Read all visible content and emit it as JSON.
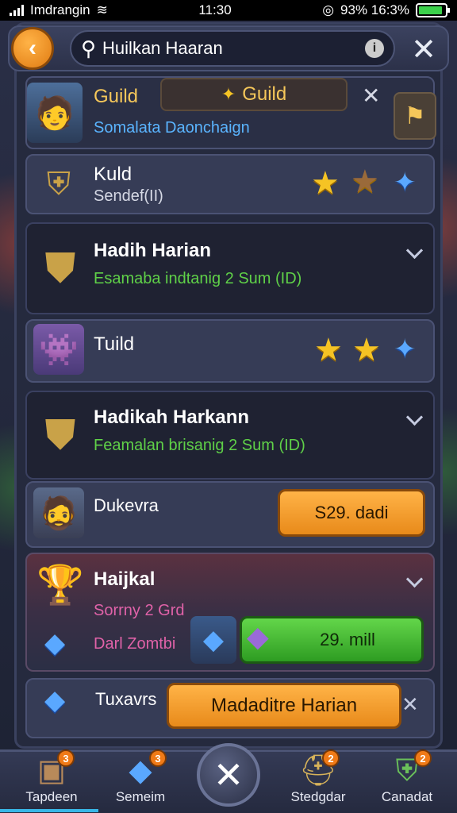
{
  "status_bar": {
    "carrier": "Imdrangin",
    "time": "11:30",
    "battery_text": "93% 16:3%"
  },
  "header": {
    "search_value": "Huilkan Haaran"
  },
  "guild_row": {
    "title": "Guild",
    "subtitle": "Somalata Daonchaign",
    "tab_label": "Guild"
  },
  "rows": [
    {
      "title": "Kuld",
      "subtitle": "Sendef(II)"
    },
    {
      "title": "Hadih Harian",
      "subtitle": "Esamaba indtanig 2 Sum (ID)"
    },
    {
      "title": "Tuild"
    },
    {
      "title": "Hadikah Harkann",
      "subtitle": "Feamalan brisanig 2 Sum (ID)"
    },
    {
      "title": "Dukevra",
      "button": "S29. dadi"
    },
    {
      "title": "Haijkal",
      "subtitle": "Sorrny 2 Grd",
      "subtitle2": "Darl Zomtbi",
      "button": "29. mill"
    },
    {
      "title": "Tuxavrs",
      "button": "Madaditre Harian"
    }
  ],
  "bottom_tabs": [
    {
      "label": "Tapdeen",
      "badge": "3"
    },
    {
      "label": "Semeim",
      "badge": "3"
    },
    {
      "label": "Stedgdar",
      "badge": "2"
    },
    {
      "label": "Canadat",
      "badge": "2"
    }
  ],
  "colors": {
    "accent_orange": "#f0982a",
    "accent_green": "#3fb42e",
    "subtitle_green": "#5fd048",
    "subtitle_blue": "#5ab4ff",
    "subtitle_pink": "#e062a8"
  }
}
